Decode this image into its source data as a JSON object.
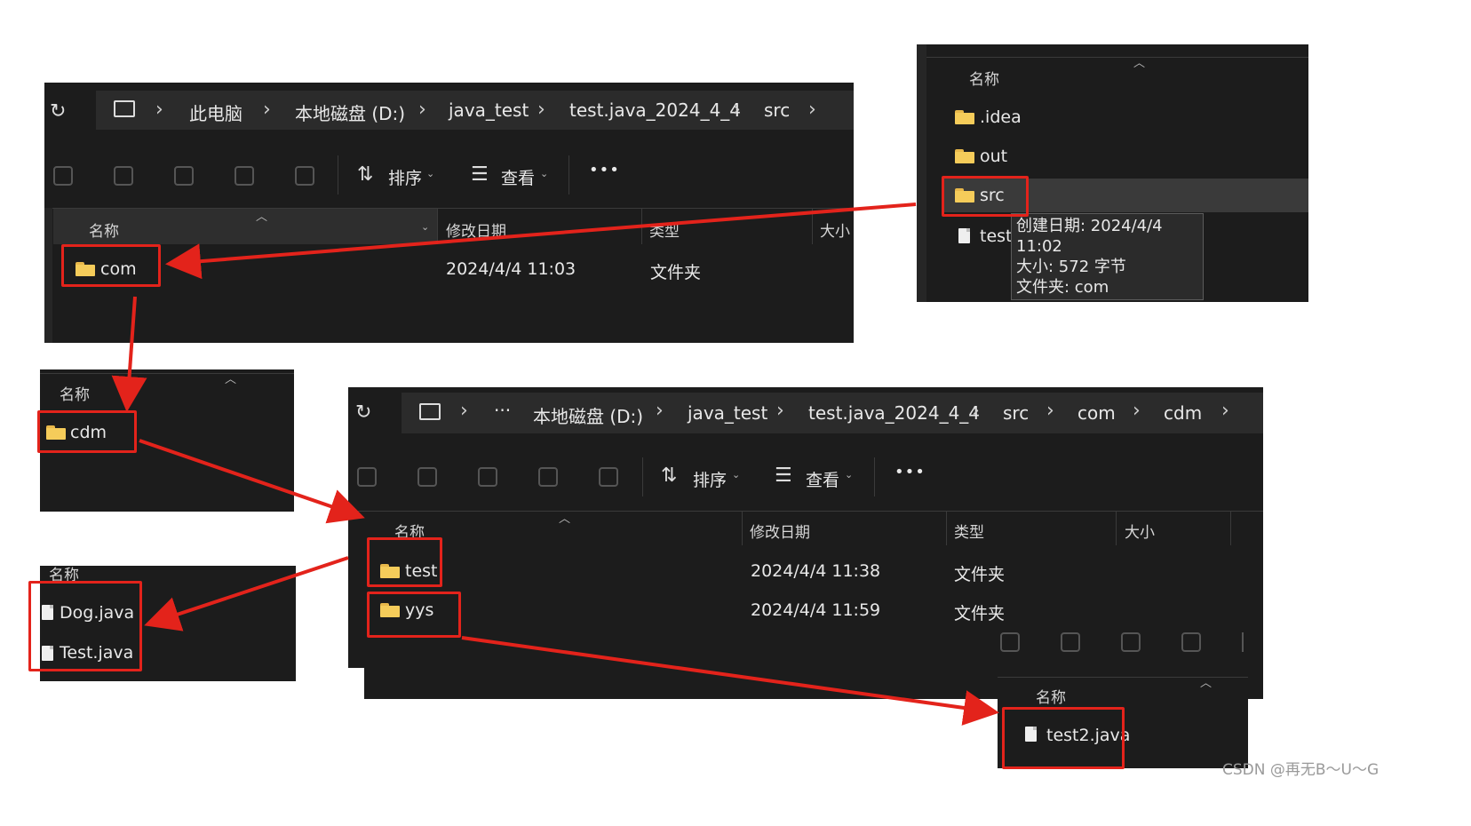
{
  "panels": {
    "p1": {
      "refresh_icon": "refresh-icon",
      "breadcrumb": [
        "此电脑",
        "本地磁盘 (D:)",
        "java_test",
        "test.java_2024_4_4",
        "src"
      ],
      "toolbar": {
        "sort_label": "排序",
        "view_label": "查看",
        "more_label": "•••"
      },
      "columns": {
        "name": "名称",
        "date": "修改日期",
        "type": "类型",
        "size": "大小"
      },
      "rows": [
        {
          "name": "com",
          "date": "2024/4/4 11:03",
          "type": "文件夹"
        }
      ]
    },
    "p2": {
      "header": "名称",
      "items": [
        ".idea",
        "out",
        "src",
        "test."
      ],
      "tooltip": [
        "创建日期: 2024/4/4 11:02",
        "大小: 572 字节",
        "文件夹: com"
      ]
    },
    "p3": {
      "header": "名称",
      "items": [
        "cdm"
      ]
    },
    "p4": {
      "header": "名称",
      "items": [
        "Dog.java",
        "Test.java"
      ]
    },
    "p5": {
      "breadcrumb_more": "···",
      "breadcrumb": [
        "本地磁盘 (D:)",
        "java_test",
        "test.java_2024_4_4",
        "src",
        "com",
        "cdm"
      ],
      "toolbar": {
        "sort_label": "排序",
        "view_label": "查看",
        "more_label": "•••"
      },
      "columns": {
        "name": "名称",
        "date": "修改日期",
        "type": "类型",
        "size": "大小"
      },
      "rows": [
        {
          "name": "test",
          "date": "2024/4/4 11:38",
          "type": "文件夹"
        },
        {
          "name": "yys",
          "date": "2024/4/4 11:59",
          "type": "文件夹"
        }
      ]
    },
    "p6": {
      "header": "名称",
      "items": [
        "test2.java"
      ]
    }
  },
  "watermark": "CSDN @再无B～U～G",
  "colors": {
    "panel_bg": "#1c1c1c",
    "annotation_red": "#e3231b",
    "folder_yellow": "#f5cc5a"
  }
}
